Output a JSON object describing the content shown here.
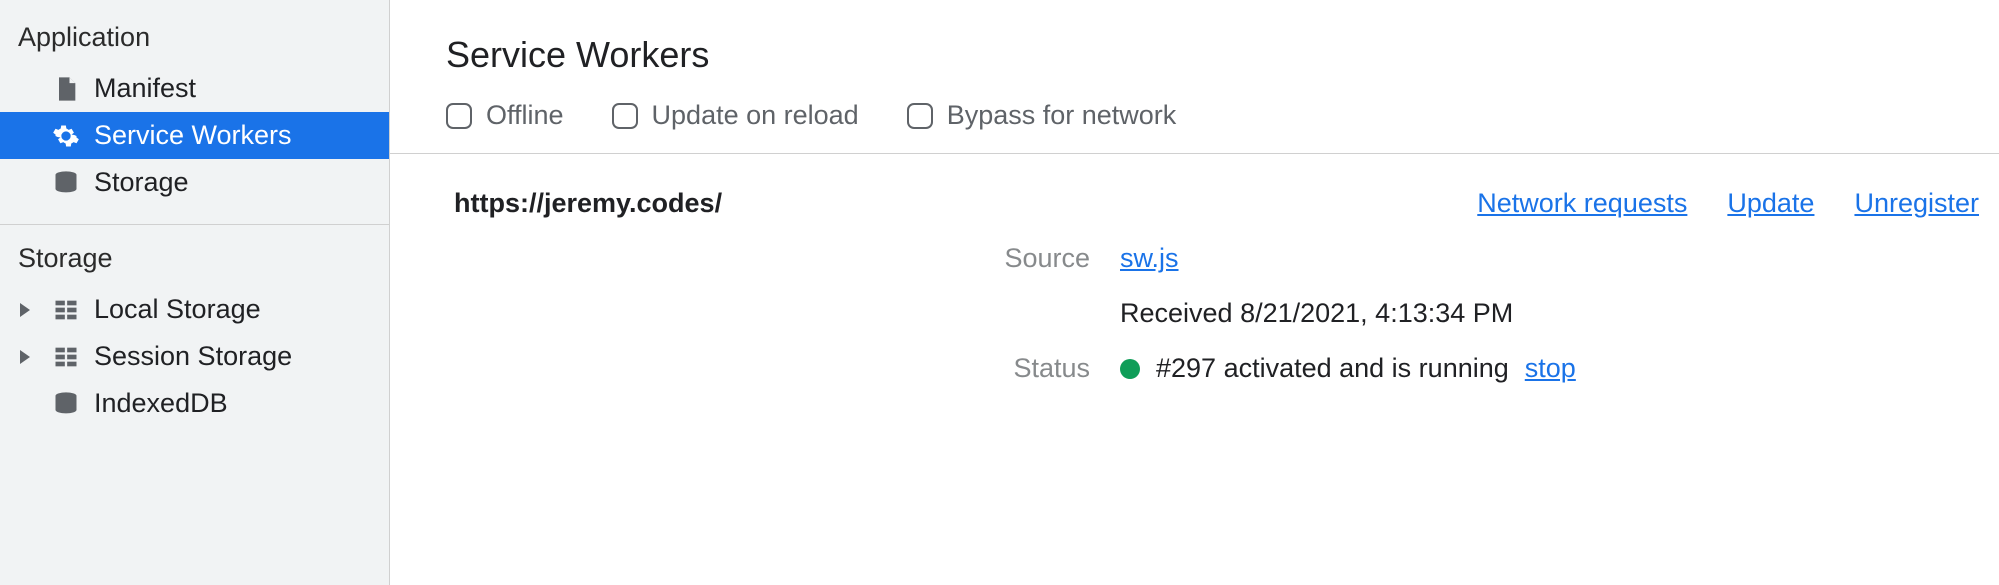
{
  "sidebar": {
    "sections": [
      {
        "title": "Application",
        "items": [
          {
            "label": "Manifest",
            "icon": "file"
          },
          {
            "label": "Service Workers",
            "icon": "gear",
            "selected": true
          },
          {
            "label": "Storage",
            "icon": "database"
          }
        ]
      },
      {
        "title": "Storage",
        "items": [
          {
            "label": "Local Storage",
            "icon": "grid",
            "expandable": true
          },
          {
            "label": "Session Storage",
            "icon": "grid",
            "expandable": true
          },
          {
            "label": "IndexedDB",
            "icon": "database"
          }
        ]
      }
    ]
  },
  "main": {
    "title": "Service Workers",
    "options": {
      "offline": "Offline",
      "update_on_reload": "Update on reload",
      "bypass_for_network": "Bypass for network"
    },
    "sw": {
      "origin": "https://jeremy.codes/",
      "actions": {
        "network_requests": "Network requests",
        "update": "Update",
        "unregister": "Unregister"
      },
      "source_label": "Source",
      "source_file": "sw.js",
      "received": "Received 8/21/2021, 4:13:34 PM",
      "status_label": "Status",
      "status_text": "#297 activated and is running",
      "stop": "stop"
    }
  }
}
